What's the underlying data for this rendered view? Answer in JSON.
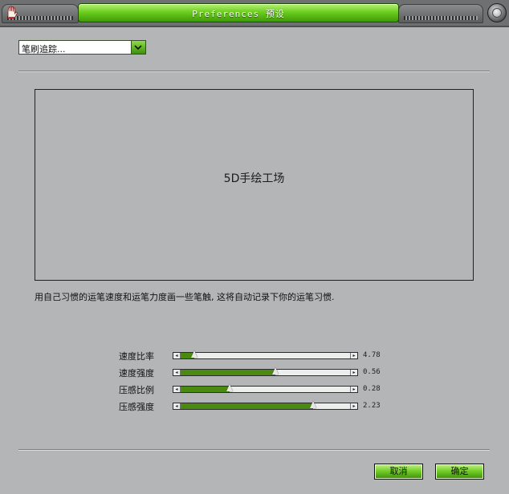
{
  "window": {
    "title": "Preferences  预设"
  },
  "dropdown": {
    "selected": "笔刷追踪..."
  },
  "canvas": {
    "text": "5D手绘工场"
  },
  "instruction": "用自己习惯的运笔速度和运笔力度画一些笔触, 这将自动记录下你的运笔习惯.",
  "sliders": [
    {
      "label": "速度比率",
      "value": "4.78",
      "fraction": 0.08
    },
    {
      "label": "速度强度",
      "value": "0.56",
      "fraction": 0.56
    },
    {
      "label": "压感比例",
      "value": "0.28",
      "fraction": 0.29
    },
    {
      "label": "压感强度",
      "value": "2.23",
      "fraction": 0.78
    }
  ],
  "buttons": {
    "cancel": "取消",
    "ok": "确定"
  },
  "colors": {
    "accent": "#6ccf1e",
    "slider_fill": "#4b8a10",
    "panel": "#b3b5b7"
  },
  "icons": [
    "hand-icon",
    "close-icon",
    "chevron-down-icon"
  ]
}
